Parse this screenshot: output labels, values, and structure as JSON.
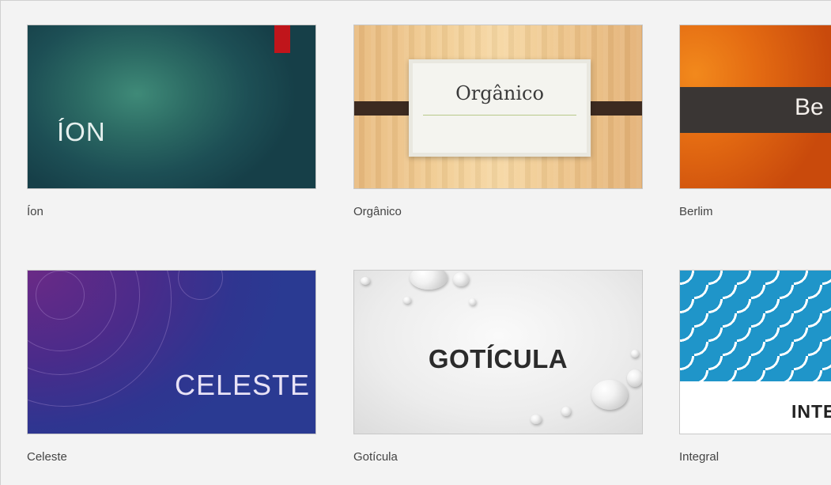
{
  "themes": [
    {
      "name": "Íon",
      "thumb_title": "ÍON"
    },
    {
      "name": "Orgânico",
      "thumb_title": "Orgânico"
    },
    {
      "name": "Berlim",
      "thumb_title": "Be"
    },
    {
      "name": "Celeste",
      "thumb_title": "CELESTE"
    },
    {
      "name": "Gotícula",
      "thumb_title": "GOTÍCULA"
    },
    {
      "name": "Integral",
      "thumb_title": "INTE"
    }
  ],
  "colors": {
    "background": "#f3f3f3",
    "ion_accent": "#c0151b",
    "berlim_orange": "#e46b12",
    "integral_blue": "#1f95c9"
  }
}
